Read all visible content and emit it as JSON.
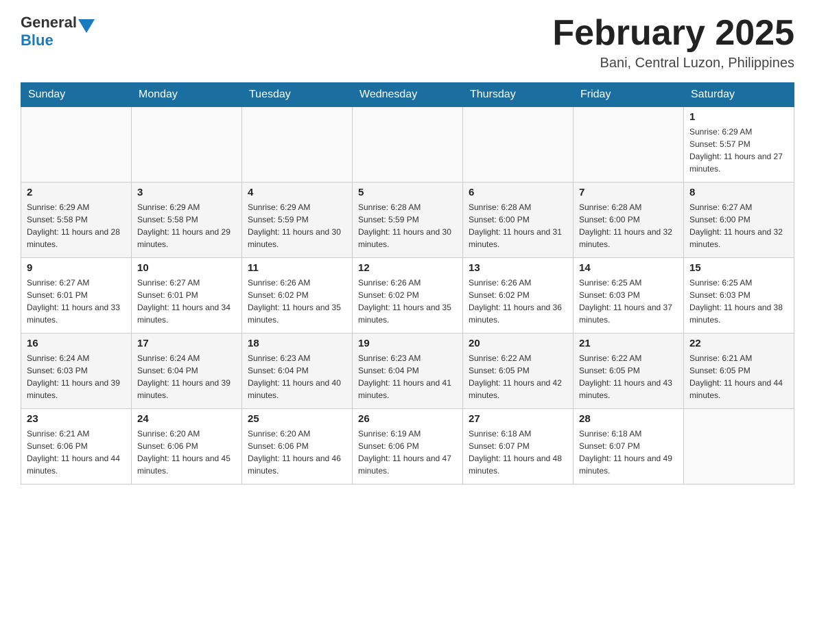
{
  "header": {
    "logo_general": "General",
    "logo_blue": "Blue",
    "title": "February 2025",
    "subtitle": "Bani, Central Luzon, Philippines"
  },
  "weekdays": [
    "Sunday",
    "Monday",
    "Tuesday",
    "Wednesday",
    "Thursday",
    "Friday",
    "Saturday"
  ],
  "weeks": [
    [
      {
        "day": "",
        "info": ""
      },
      {
        "day": "",
        "info": ""
      },
      {
        "day": "",
        "info": ""
      },
      {
        "day": "",
        "info": ""
      },
      {
        "day": "",
        "info": ""
      },
      {
        "day": "",
        "info": ""
      },
      {
        "day": "1",
        "info": "Sunrise: 6:29 AM\nSunset: 5:57 PM\nDaylight: 11 hours and 27 minutes."
      }
    ],
    [
      {
        "day": "2",
        "info": "Sunrise: 6:29 AM\nSunset: 5:58 PM\nDaylight: 11 hours and 28 minutes."
      },
      {
        "day": "3",
        "info": "Sunrise: 6:29 AM\nSunset: 5:58 PM\nDaylight: 11 hours and 29 minutes."
      },
      {
        "day": "4",
        "info": "Sunrise: 6:29 AM\nSunset: 5:59 PM\nDaylight: 11 hours and 30 minutes."
      },
      {
        "day": "5",
        "info": "Sunrise: 6:28 AM\nSunset: 5:59 PM\nDaylight: 11 hours and 30 minutes."
      },
      {
        "day": "6",
        "info": "Sunrise: 6:28 AM\nSunset: 6:00 PM\nDaylight: 11 hours and 31 minutes."
      },
      {
        "day": "7",
        "info": "Sunrise: 6:28 AM\nSunset: 6:00 PM\nDaylight: 11 hours and 32 minutes."
      },
      {
        "day": "8",
        "info": "Sunrise: 6:27 AM\nSunset: 6:00 PM\nDaylight: 11 hours and 32 minutes."
      }
    ],
    [
      {
        "day": "9",
        "info": "Sunrise: 6:27 AM\nSunset: 6:01 PM\nDaylight: 11 hours and 33 minutes."
      },
      {
        "day": "10",
        "info": "Sunrise: 6:27 AM\nSunset: 6:01 PM\nDaylight: 11 hours and 34 minutes."
      },
      {
        "day": "11",
        "info": "Sunrise: 6:26 AM\nSunset: 6:02 PM\nDaylight: 11 hours and 35 minutes."
      },
      {
        "day": "12",
        "info": "Sunrise: 6:26 AM\nSunset: 6:02 PM\nDaylight: 11 hours and 35 minutes."
      },
      {
        "day": "13",
        "info": "Sunrise: 6:26 AM\nSunset: 6:02 PM\nDaylight: 11 hours and 36 minutes."
      },
      {
        "day": "14",
        "info": "Sunrise: 6:25 AM\nSunset: 6:03 PM\nDaylight: 11 hours and 37 minutes."
      },
      {
        "day": "15",
        "info": "Sunrise: 6:25 AM\nSunset: 6:03 PM\nDaylight: 11 hours and 38 minutes."
      }
    ],
    [
      {
        "day": "16",
        "info": "Sunrise: 6:24 AM\nSunset: 6:03 PM\nDaylight: 11 hours and 39 minutes."
      },
      {
        "day": "17",
        "info": "Sunrise: 6:24 AM\nSunset: 6:04 PM\nDaylight: 11 hours and 39 minutes."
      },
      {
        "day": "18",
        "info": "Sunrise: 6:23 AM\nSunset: 6:04 PM\nDaylight: 11 hours and 40 minutes."
      },
      {
        "day": "19",
        "info": "Sunrise: 6:23 AM\nSunset: 6:04 PM\nDaylight: 11 hours and 41 minutes."
      },
      {
        "day": "20",
        "info": "Sunrise: 6:22 AM\nSunset: 6:05 PM\nDaylight: 11 hours and 42 minutes."
      },
      {
        "day": "21",
        "info": "Sunrise: 6:22 AM\nSunset: 6:05 PM\nDaylight: 11 hours and 43 minutes."
      },
      {
        "day": "22",
        "info": "Sunrise: 6:21 AM\nSunset: 6:05 PM\nDaylight: 11 hours and 44 minutes."
      }
    ],
    [
      {
        "day": "23",
        "info": "Sunrise: 6:21 AM\nSunset: 6:06 PM\nDaylight: 11 hours and 44 minutes."
      },
      {
        "day": "24",
        "info": "Sunrise: 6:20 AM\nSunset: 6:06 PM\nDaylight: 11 hours and 45 minutes."
      },
      {
        "day": "25",
        "info": "Sunrise: 6:20 AM\nSunset: 6:06 PM\nDaylight: 11 hours and 46 minutes."
      },
      {
        "day": "26",
        "info": "Sunrise: 6:19 AM\nSunset: 6:06 PM\nDaylight: 11 hours and 47 minutes."
      },
      {
        "day": "27",
        "info": "Sunrise: 6:18 AM\nSunset: 6:07 PM\nDaylight: 11 hours and 48 minutes."
      },
      {
        "day": "28",
        "info": "Sunrise: 6:18 AM\nSunset: 6:07 PM\nDaylight: 11 hours and 49 minutes."
      },
      {
        "day": "",
        "info": ""
      }
    ]
  ]
}
